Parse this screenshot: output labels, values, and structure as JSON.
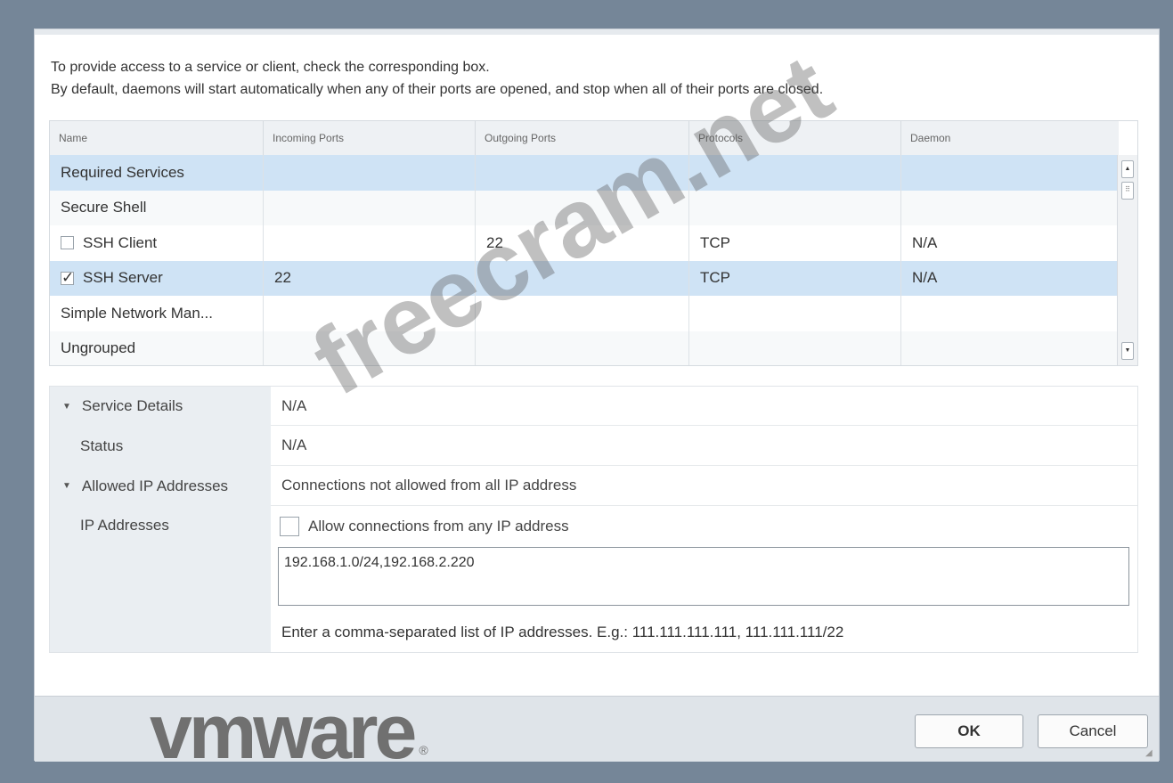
{
  "intro": {
    "line1": "To provide access to a service or client, check the corresponding box.",
    "line2": "By default, daemons will start automatically when any of their ports are opened, and stop when all of their ports are closed."
  },
  "table": {
    "columns": [
      "Name",
      "Incoming Ports",
      "Outgoing Ports",
      "Protocols",
      "Daemon"
    ],
    "rows": [
      {
        "name": "Required Services",
        "incoming": "",
        "outgoing": "",
        "protocols": "",
        "daemon": ""
      },
      {
        "name": "Secure Shell",
        "incoming": "",
        "outgoing": "",
        "protocols": "",
        "daemon": ""
      },
      {
        "name": "SSH Client",
        "incoming": "",
        "outgoing": "22",
        "protocols": "TCP",
        "daemon": "N/A",
        "checked": false
      },
      {
        "name": "SSH Server",
        "incoming": "22",
        "outgoing": "",
        "protocols": "TCP",
        "daemon": "N/A",
        "checked": true
      },
      {
        "name": "Simple Network Man...",
        "incoming": "",
        "outgoing": "",
        "protocols": "",
        "daemon": ""
      },
      {
        "name": "Ungrouped",
        "incoming": "",
        "outgoing": "",
        "protocols": "",
        "daemon": ""
      }
    ]
  },
  "details": {
    "service_details_label": "Service Details",
    "service_details_value": "N/A",
    "status_label": "Status",
    "status_value": "N/A",
    "allowed_ip_label": "Allowed IP Addresses",
    "allowed_ip_value": "Connections not allowed from all IP address",
    "ip_addresses_label": "IP Addresses",
    "allow_any_label": "Allow connections from any IP address",
    "allow_any_checked": false,
    "ip_value": "192.168.1.0/24,192.168.2.220",
    "hint": "Enter a comma-separated list of IP addresses. E.g.: 111.111.111.111, 111.111.111/22"
  },
  "buttons": {
    "ok": "OK",
    "cancel": "Cancel"
  },
  "logo": {
    "text": "vmware",
    "mark": "®"
  },
  "watermark": "freecram.net"
}
